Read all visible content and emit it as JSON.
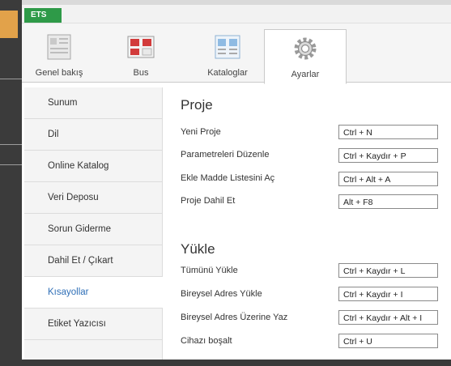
{
  "app": {
    "tab_label": "ETS"
  },
  "ribbon": {
    "tabs": [
      {
        "label": "Genel bakış",
        "icon": "overview-icon"
      },
      {
        "label": "Bus",
        "icon": "bus-icon"
      },
      {
        "label": "Kataloglar",
        "icon": "catalogs-icon"
      },
      {
        "label": "Ayarlar",
        "icon": "gear-icon",
        "active": true
      }
    ]
  },
  "sidebar": {
    "items": [
      {
        "label": "Sunum"
      },
      {
        "label": "Dil"
      },
      {
        "label": "Online Katalog"
      },
      {
        "label": "Veri Deposu"
      },
      {
        "label": "Sorun Giderme"
      },
      {
        "label": "Dahil Et / Çıkart"
      },
      {
        "label": "Kısayollar",
        "active": true
      },
      {
        "label": "Etiket Yazıcısı"
      }
    ]
  },
  "sections": [
    {
      "title": "Proje",
      "rows": [
        {
          "label": "Yeni Proje",
          "shortcut": "Ctrl + N"
        },
        {
          "label": "Parametreleri Düzenle",
          "shortcut": "Ctrl + Kaydır + P"
        },
        {
          "label": "Ekle Madde Listesini Aç",
          "shortcut": "Ctrl + Alt + A"
        },
        {
          "label": "Proje Dahil Et",
          "shortcut": "Alt + F8"
        }
      ]
    },
    {
      "title": "Yükle",
      "rows": [
        {
          "label": "Tümünü Yükle",
          "shortcut": "Ctrl + Kaydır + L"
        },
        {
          "label": "Bireysel Adres Yükle",
          "shortcut": "Ctrl + Kaydır + I"
        },
        {
          "label": "Bireysel Adres Üzerine Yaz",
          "shortcut": "Ctrl + Kaydır + Alt + I"
        },
        {
          "label": "Cihazı boşalt",
          "shortcut": "Ctrl + U"
        }
      ]
    }
  ],
  "colors": {
    "ets_green": "#2e9a48",
    "active_link": "#2f6fb7",
    "accent_tan": "#e2a24a"
  }
}
